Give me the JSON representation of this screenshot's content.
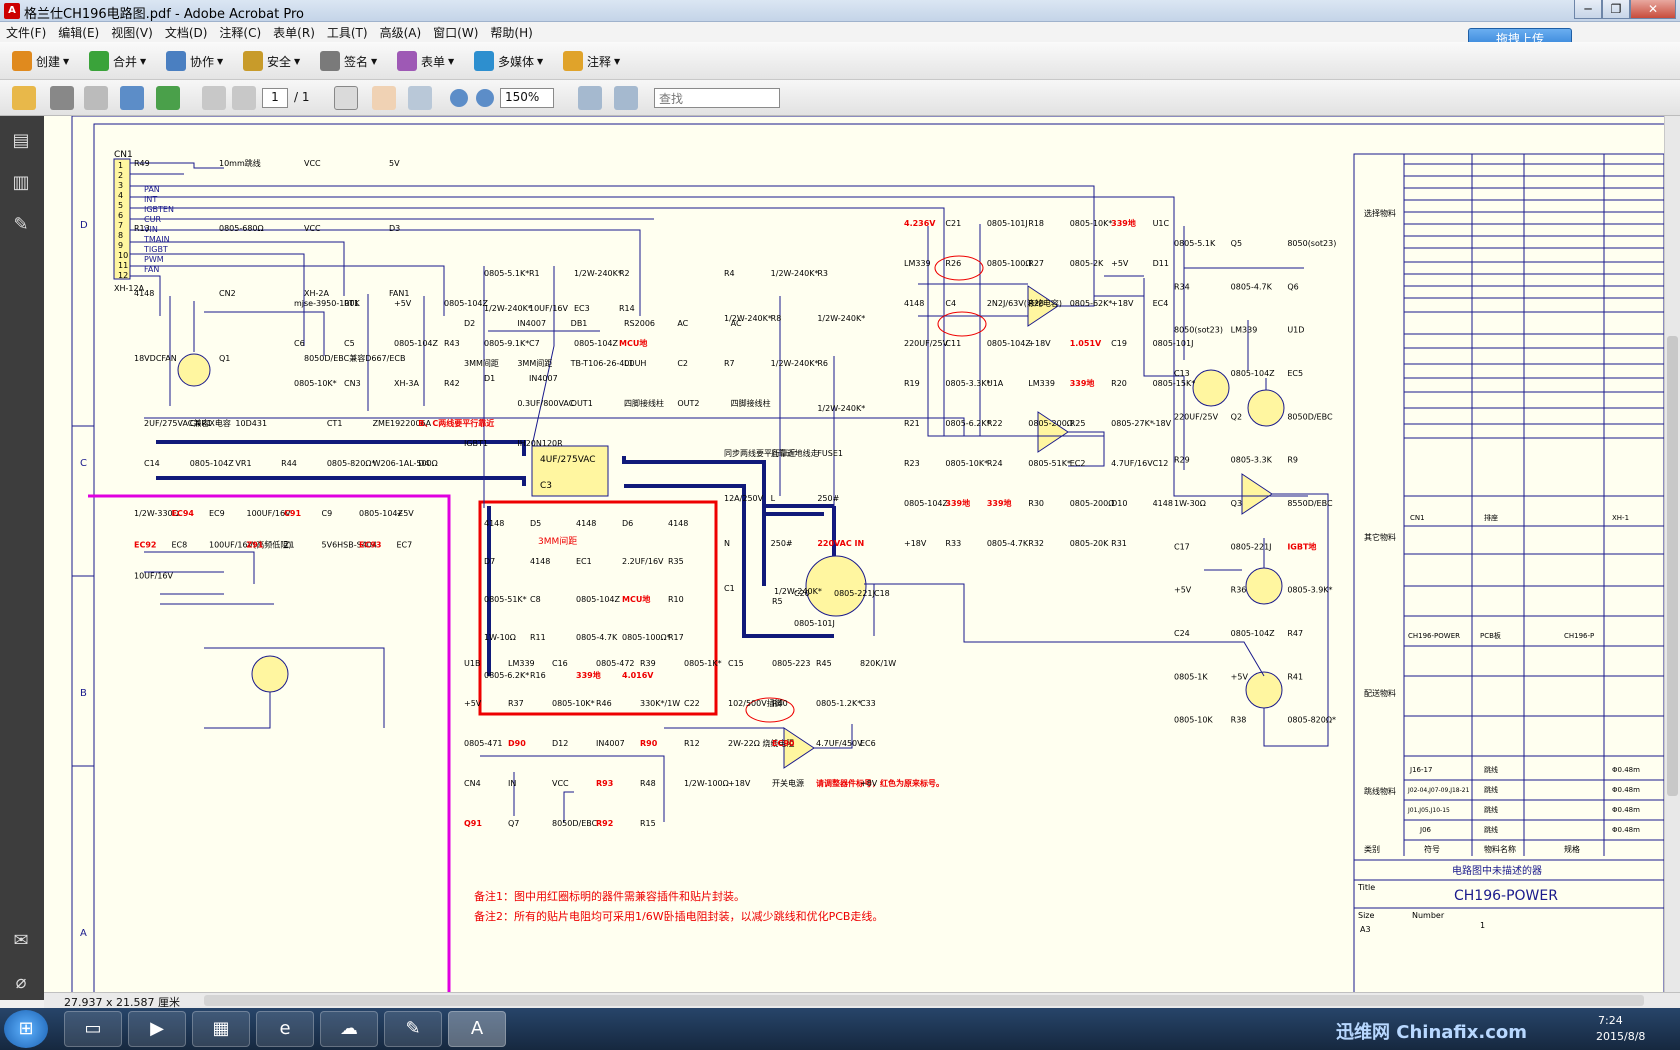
{
  "window": {
    "title": "格兰仕CH196电路图.pdf - Adobe Acrobat Pro",
    "buttons": [
      "─",
      "❐",
      "✕"
    ]
  },
  "menu": [
    "文件(F)",
    "编辑(E)",
    "视图(V)",
    "文档(D)",
    "注释(C)",
    "表单(R)",
    "工具(T)",
    "高级(A)",
    "窗口(W)",
    "帮助(H)"
  ],
  "toolbar1": [
    {
      "label": "创建",
      "icon": "create-icon",
      "color": "#e08a1e"
    },
    {
      "label": "合并",
      "icon": "combine-icon",
      "color": "#3aa33a"
    },
    {
      "label": "协作",
      "icon": "collaborate-icon",
      "color": "#4a7fc1"
    },
    {
      "label": "安全",
      "icon": "lock-icon",
      "color": "#c89b2a"
    },
    {
      "label": "签名",
      "icon": "pen-icon",
      "color": "#7a7a7a"
    },
    {
      "label": "表单",
      "icon": "form-icon",
      "color": "#9e59b5"
    },
    {
      "label": "多媒体",
      "icon": "film-icon",
      "color": "#2d8fcf"
    },
    {
      "label": "注释",
      "icon": "comment-icon",
      "color": "#e0a32a"
    }
  ],
  "upload_button": "拖拽上传",
  "toolbar2": {
    "page_current": "1",
    "page_total": "/ 1",
    "zoom": "150%",
    "search_placeholder": "查找"
  },
  "status": {
    "dimensions": "27.937 x 21.587 厘米"
  },
  "schematic": {
    "border_letters": [
      "D",
      "C",
      "B",
      "A"
    ],
    "connector_cn1": {
      "name": "CN1",
      "pins": [
        "1",
        "2",
        "3",
        "4",
        "5",
        "6",
        "7",
        "8",
        "9",
        "10",
        "11",
        "12"
      ],
      "part": "XH-12A",
      "signals": [
        "PAN",
        "INT",
        "IGBTEN",
        "CUR",
        "VIN",
        "TMAIN",
        "TIGBT",
        "PWM",
        "FAN"
      ]
    },
    "labels": [
      "R49",
      "10mm跳线",
      "VCC",
      "5V",
      "R13",
      "0805-680Ω",
      "VCC",
      "D3",
      "4148",
      "CN2",
      "XH-2A",
      "FAN1",
      "18VDCFAN",
      "Q1",
      "8050D/EBC兼容D667/ECB",
      "mjse-3950-100K",
      "RT1",
      "+5V",
      "0805-104Z",
      "C6",
      "C5",
      "0805-104Z",
      "R43",
      "0805-10K*",
      "CN3",
      "XH-3A",
      "R42",
      "0805-5.1K*",
      "R1",
      "1/2W-240K*",
      "R2",
      "1/2W-240K*",
      "10UF/16V",
      "EC3",
      "R14",
      "0805-9.1K*",
      "C7",
      "0805-104Z",
      "MCU地",
      "D1",
      "IN4007",
      "D2",
      "IN4007",
      "DB1",
      "RS2006",
      "AC",
      "AC",
      "3MM间距",
      "3MM间距",
      "TB-T106-26-400UH",
      "L1",
      "C2",
      "4UF/275VAC",
      "C3",
      "0.3UF/800VAC",
      "OUT1",
      "四脚接线柱",
      "OUT2",
      "四脚接线柱",
      "IGBT1",
      "IH20N120R",
      "R4",
      "1/2W-240K*",
      "R3",
      "1/2W-240K*",
      "R8",
      "1/2W-240K*",
      "R7",
      "1/2W-240K*",
      "R6",
      "1/2W-240K*",
      "R5",
      "1/2W-240K*",
      "同步两线要平行靠近",
      "且靠近地线走",
      "FUSE1",
      "12A/250V",
      "L",
      "250#",
      "N",
      "250#",
      "220VAC IN",
      "C1",
      "2UF/275VAC兼容X电容",
      "CNR1",
      "10D431",
      "3MM间距",
      "CT1",
      "ZME1922006A",
      "B、C两线要平行靠近",
      "C14",
      "0805-104Z",
      "VR1",
      "R44",
      "0805-820Ω*",
      "W206-1AL-500Ω",
      "D4",
      "4148",
      "D5",
      "4148",
      "D6",
      "4148",
      "D7",
      "4148",
      "EC1",
      "2.2UF/16V",
      "R35",
      "0805-51K*",
      "C8",
      "0805-104Z",
      "MCU地",
      "R10",
      "1W-10Ω",
      "R11",
      "0805-4.7K",
      "0805-100Ω*",
      "R17",
      "0805-6.2K*",
      "R16",
      "339地",
      "4.016V",
      "C20",
      "0805-221J",
      "C18",
      "0805-101J",
      "4.236V",
      "C21",
      "0805-101J",
      "R18",
      "0805-10K*",
      "339地",
      "U1C",
      "LM339",
      "R26",
      "0805-100Ω",
      "R27",
      "0805-2K",
      "+5V",
      "D11",
      "4148",
      "C4",
      "2N2J/63V(涤纶电容)",
      "R28",
      "0805-62K*",
      "+18V",
      "EC4",
      "220UF/25V",
      "C11",
      "0805-104Z",
      "+18V",
      "1.051V",
      "C19",
      "0805-101J",
      "R19",
      "0805-3.3K*",
      "U1A",
      "LM339",
      "339地",
      "R20",
      "0805-15K*",
      "R21",
      "0805-6.2K*",
      "R22",
      "0805-200Ω",
      "R25",
      "0805-27K*",
      "-18V",
      "R23",
      "0805-10K*",
      "R24",
      "0805-51K*",
      "EC2",
      "4.7UF/16V",
      "C12",
      "0805-104Z",
      "339地",
      "339地",
      "R30",
      "0805-200Ω",
      "D10",
      "4148",
      "+18V",
      "R33",
      "0805-4.7K",
      "R32",
      "0805-20K",
      "R31",
      "0805-5.1K",
      "Q5",
      "8050(sot23)",
      "R34",
      "0805-4.7K",
      "Q6",
      "8050(sot23)",
      "LM339",
      "U1D",
      "C13",
      "0805-104Z",
      "EC5",
      "220UF/25V",
      "Q2",
      "8050D/EBC",
      "R29",
      "0805-3.3K",
      "R9",
      "1W-30Ω",
      "Q3",
      "8550D/EBC",
      "C17",
      "0805-221J",
      "IGBT地",
      "+5V",
      "R36",
      "0805-3.9K*",
      "C24",
      "0805-104Z",
      "R47",
      "0805-1K",
      "+5V",
      "R41",
      "0805-10K",
      "R38",
      "0805-820Ω*",
      "U1B",
      "LM339",
      "C16",
      "0805-472",
      "R39",
      "0805-1K*",
      "C15",
      "0805-223",
      "R45",
      "820K/1W",
      "+5V",
      "R37",
      "0805-10K*",
      "R46",
      "330K*/1W",
      "C22",
      "102/500V插脚",
      "R40",
      "0805-1.2K*",
      "C33",
      "0805-471",
      "D90",
      "D12",
      "IN4007",
      "R90",
      "R12",
      "2W-22Ω 烧线电阻",
      "EC90",
      "4.7UF/450V",
      "EC6",
      "CN4",
      "IN",
      "VCC",
      "R93",
      "R48",
      "1/2W-100Ω",
      "+18V",
      "开关电源",
      "请调整器件标号，红色为原来标号。",
      "+8V",
      "Q91",
      "Q7",
      "8050D/EBC",
      "R92",
      "R15",
      "1/2W-330Ω",
      "EC94",
      "EC9",
      "100UF/16V",
      "C91",
      "C9",
      "0805-104Z",
      "+5V",
      "EC92",
      "EC8",
      "100UF/16V(高频低阻)",
      "Z91",
      "Z1",
      "5V6HSB-S404",
      "EC93",
      "EC7",
      "10UF/16V"
    ],
    "notes": [
      "备注1：图中用红圈标明的器件需兼容插件和贴片封装。",
      "备注2：所有的贴片电阻均可采用1/6W卧插电阻封装，以减少跳线和优化PCB走线。"
    ],
    "title_block": {
      "rows": [
        {
          "label": "选择物料",
          "cells": []
        },
        {
          "label": "其它物料",
          "cells": [
            "CN1",
            "排座",
            "XH-1"
          ]
        },
        {
          "label": "",
          "cells": [
            "CH196-POWER",
            "PCB板",
            "CH196-P"
          ]
        },
        {
          "label": "配送物料",
          "cells": []
        },
        {
          "label": "跳线物料",
          "cells": [
            "J16-17",
            "跳线",
            "Φ0.48m",
            "J02-04,J07-09,J18-21",
            "跳线",
            "Φ0.48m",
            "J01,J05,J10-15",
            "跳线",
            "Φ0.48m",
            "J06",
            "跳线",
            "Φ0.48m"
          ]
        },
        {
          "label": "类别",
          "cells": [
            "符号",
            "物料名称",
            "规格"
          ]
        }
      ],
      "desc": "电路图中未描述的器",
      "title_label": "Title",
      "title": "CH196-POWER",
      "size_label": "Size",
      "size": "A3",
      "number_label": "Number",
      "number": "1"
    }
  },
  "taskbar": {
    "apps": [
      "folder-icon",
      "media-player-icon",
      "file-manager-icon",
      "ie-icon",
      "cloud-icon",
      "paint-icon",
      "acrobat-icon"
    ],
    "time": "7:24",
    "date": "2015/8/8",
    "watermark": "迅维网 Chinafix.com"
  }
}
